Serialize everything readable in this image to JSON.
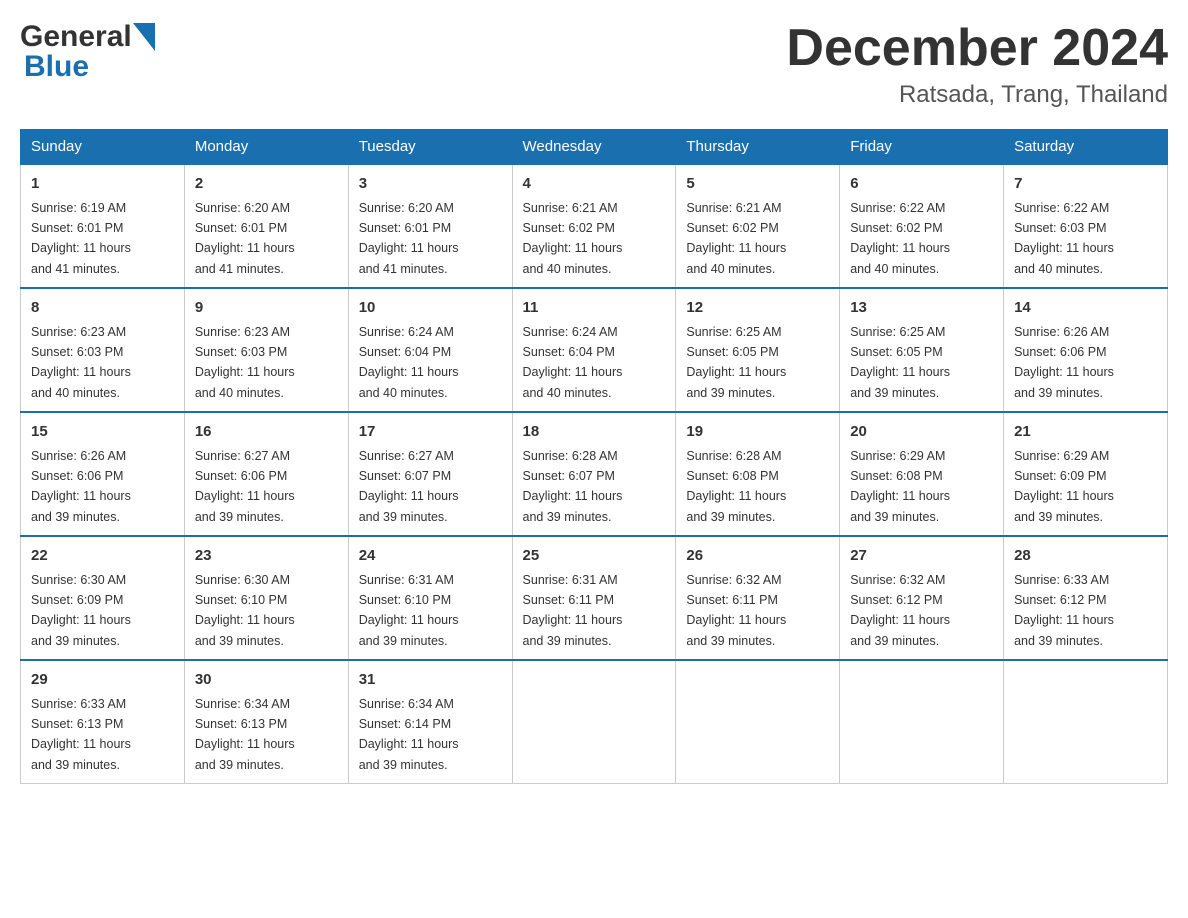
{
  "logo": {
    "general": "General",
    "blue": "Blue"
  },
  "title": "December 2024",
  "location": "Ratsada, Trang, Thailand",
  "days_of_week": [
    "Sunday",
    "Monday",
    "Tuesday",
    "Wednesday",
    "Thursday",
    "Friday",
    "Saturday"
  ],
  "weeks": [
    [
      {
        "num": "1",
        "sunrise": "6:19 AM",
        "sunset": "6:01 PM",
        "daylight": "11 hours and 41 minutes."
      },
      {
        "num": "2",
        "sunrise": "6:20 AM",
        "sunset": "6:01 PM",
        "daylight": "11 hours and 41 minutes."
      },
      {
        "num": "3",
        "sunrise": "6:20 AM",
        "sunset": "6:01 PM",
        "daylight": "11 hours and 41 minutes."
      },
      {
        "num": "4",
        "sunrise": "6:21 AM",
        "sunset": "6:02 PM",
        "daylight": "11 hours and 40 minutes."
      },
      {
        "num": "5",
        "sunrise": "6:21 AM",
        "sunset": "6:02 PM",
        "daylight": "11 hours and 40 minutes."
      },
      {
        "num": "6",
        "sunrise": "6:22 AM",
        "sunset": "6:02 PM",
        "daylight": "11 hours and 40 minutes."
      },
      {
        "num": "7",
        "sunrise": "6:22 AM",
        "sunset": "6:03 PM",
        "daylight": "11 hours and 40 minutes."
      }
    ],
    [
      {
        "num": "8",
        "sunrise": "6:23 AM",
        "sunset": "6:03 PM",
        "daylight": "11 hours and 40 minutes."
      },
      {
        "num": "9",
        "sunrise": "6:23 AM",
        "sunset": "6:03 PM",
        "daylight": "11 hours and 40 minutes."
      },
      {
        "num": "10",
        "sunrise": "6:24 AM",
        "sunset": "6:04 PM",
        "daylight": "11 hours and 40 minutes."
      },
      {
        "num": "11",
        "sunrise": "6:24 AM",
        "sunset": "6:04 PM",
        "daylight": "11 hours and 40 minutes."
      },
      {
        "num": "12",
        "sunrise": "6:25 AM",
        "sunset": "6:05 PM",
        "daylight": "11 hours and 39 minutes."
      },
      {
        "num": "13",
        "sunrise": "6:25 AM",
        "sunset": "6:05 PM",
        "daylight": "11 hours and 39 minutes."
      },
      {
        "num": "14",
        "sunrise": "6:26 AM",
        "sunset": "6:06 PM",
        "daylight": "11 hours and 39 minutes."
      }
    ],
    [
      {
        "num": "15",
        "sunrise": "6:26 AM",
        "sunset": "6:06 PM",
        "daylight": "11 hours and 39 minutes."
      },
      {
        "num": "16",
        "sunrise": "6:27 AM",
        "sunset": "6:06 PM",
        "daylight": "11 hours and 39 minutes."
      },
      {
        "num": "17",
        "sunrise": "6:27 AM",
        "sunset": "6:07 PM",
        "daylight": "11 hours and 39 minutes."
      },
      {
        "num": "18",
        "sunrise": "6:28 AM",
        "sunset": "6:07 PM",
        "daylight": "11 hours and 39 minutes."
      },
      {
        "num": "19",
        "sunrise": "6:28 AM",
        "sunset": "6:08 PM",
        "daylight": "11 hours and 39 minutes."
      },
      {
        "num": "20",
        "sunrise": "6:29 AM",
        "sunset": "6:08 PM",
        "daylight": "11 hours and 39 minutes."
      },
      {
        "num": "21",
        "sunrise": "6:29 AM",
        "sunset": "6:09 PM",
        "daylight": "11 hours and 39 minutes."
      }
    ],
    [
      {
        "num": "22",
        "sunrise": "6:30 AM",
        "sunset": "6:09 PM",
        "daylight": "11 hours and 39 minutes."
      },
      {
        "num": "23",
        "sunrise": "6:30 AM",
        "sunset": "6:10 PM",
        "daylight": "11 hours and 39 minutes."
      },
      {
        "num": "24",
        "sunrise": "6:31 AM",
        "sunset": "6:10 PM",
        "daylight": "11 hours and 39 minutes."
      },
      {
        "num": "25",
        "sunrise": "6:31 AM",
        "sunset": "6:11 PM",
        "daylight": "11 hours and 39 minutes."
      },
      {
        "num": "26",
        "sunrise": "6:32 AM",
        "sunset": "6:11 PM",
        "daylight": "11 hours and 39 minutes."
      },
      {
        "num": "27",
        "sunrise": "6:32 AM",
        "sunset": "6:12 PM",
        "daylight": "11 hours and 39 minutes."
      },
      {
        "num": "28",
        "sunrise": "6:33 AM",
        "sunset": "6:12 PM",
        "daylight": "11 hours and 39 minutes."
      }
    ],
    [
      {
        "num": "29",
        "sunrise": "6:33 AM",
        "sunset": "6:13 PM",
        "daylight": "11 hours and 39 minutes."
      },
      {
        "num": "30",
        "sunrise": "6:34 AM",
        "sunset": "6:13 PM",
        "daylight": "11 hours and 39 minutes."
      },
      {
        "num": "31",
        "sunrise": "6:34 AM",
        "sunset": "6:14 PM",
        "daylight": "11 hours and 39 minutes."
      },
      null,
      null,
      null,
      null
    ]
  ],
  "labels": {
    "sunrise": "Sunrise:",
    "sunset": "Sunset:",
    "daylight": "Daylight:"
  }
}
